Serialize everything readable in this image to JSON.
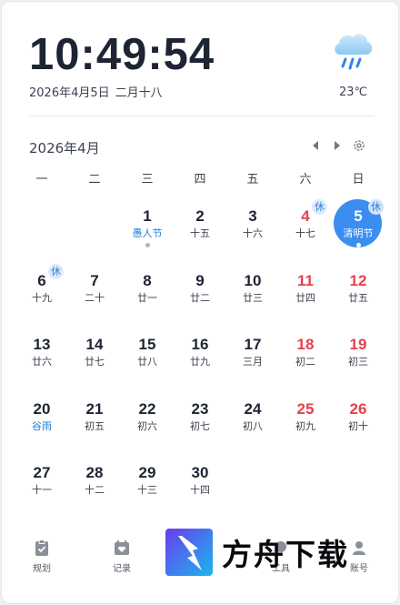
{
  "clock": {
    "time": "10:49:54",
    "date": "2026年4月5日",
    "lunar": "二月十八"
  },
  "weather": {
    "icon": "rain-cloud-icon",
    "temperature": "23℃"
  },
  "calendar": {
    "month_label": "2026年4月",
    "weekdays": [
      "一",
      "二",
      "三",
      "四",
      "五",
      "六",
      "日"
    ],
    "days": [
      {
        "col": 3,
        "day": "1",
        "sub": "愚人节",
        "festival": true,
        "dot": true
      },
      {
        "col": 4,
        "day": "2",
        "sub": "十五"
      },
      {
        "col": 5,
        "day": "3",
        "sub": "十六"
      },
      {
        "col": 6,
        "day": "4",
        "sub": "十七",
        "weekend": true,
        "badge": "休"
      },
      {
        "col": 7,
        "day": "5",
        "sub": "清明节",
        "today": true,
        "dot": true,
        "badge": "休"
      },
      {
        "col": 1,
        "day": "6",
        "sub": "十九",
        "badge": "休"
      },
      {
        "col": 2,
        "day": "7",
        "sub": "二十"
      },
      {
        "col": 3,
        "day": "8",
        "sub": "廿一"
      },
      {
        "col": 4,
        "day": "9",
        "sub": "廿二"
      },
      {
        "col": 5,
        "day": "10",
        "sub": "廿三"
      },
      {
        "col": 6,
        "day": "11",
        "sub": "廿四",
        "weekend": true
      },
      {
        "col": 7,
        "day": "12",
        "sub": "廿五",
        "weekend": true
      },
      {
        "col": 1,
        "day": "13",
        "sub": "廿六"
      },
      {
        "col": 2,
        "day": "14",
        "sub": "廿七"
      },
      {
        "col": 3,
        "day": "15",
        "sub": "廿八"
      },
      {
        "col": 4,
        "day": "16",
        "sub": "廿九"
      },
      {
        "col": 5,
        "day": "17",
        "sub": "三月"
      },
      {
        "col": 6,
        "day": "18",
        "sub": "初二",
        "weekend": true
      },
      {
        "col": 7,
        "day": "19",
        "sub": "初三",
        "weekend": true
      },
      {
        "col": 1,
        "day": "20",
        "sub": "谷雨",
        "festival": true
      },
      {
        "col": 2,
        "day": "21",
        "sub": "初五"
      },
      {
        "col": 3,
        "day": "22",
        "sub": "初六"
      },
      {
        "col": 4,
        "day": "23",
        "sub": "初七"
      },
      {
        "col": 5,
        "day": "24",
        "sub": "初八"
      },
      {
        "col": 6,
        "day": "25",
        "sub": "初九",
        "weekend": true
      },
      {
        "col": 7,
        "day": "26",
        "sub": "初十",
        "weekend": true
      },
      {
        "col": 1,
        "day": "27",
        "sub": "十一"
      },
      {
        "col": 2,
        "day": "28",
        "sub": "十二"
      },
      {
        "col": 3,
        "day": "29",
        "sub": "十三"
      },
      {
        "col": 4,
        "day": "30",
        "sub": "十四"
      }
    ]
  },
  "toolbar": {
    "items": [
      {
        "label": "规划",
        "icon": "clipboard-check-icon"
      },
      {
        "label": "记录",
        "icon": "calendar-heart-icon"
      },
      {
        "label": "工具",
        "icon": "tool-icon"
      },
      {
        "label": "账号",
        "icon": "account-icon"
      }
    ]
  },
  "watermark": {
    "text": "方舟下载"
  },
  "colors": {
    "accent": "#3a8ef0",
    "weekend": "#e5414b",
    "festival": "#1f7fd6",
    "text": "#1d2433"
  }
}
